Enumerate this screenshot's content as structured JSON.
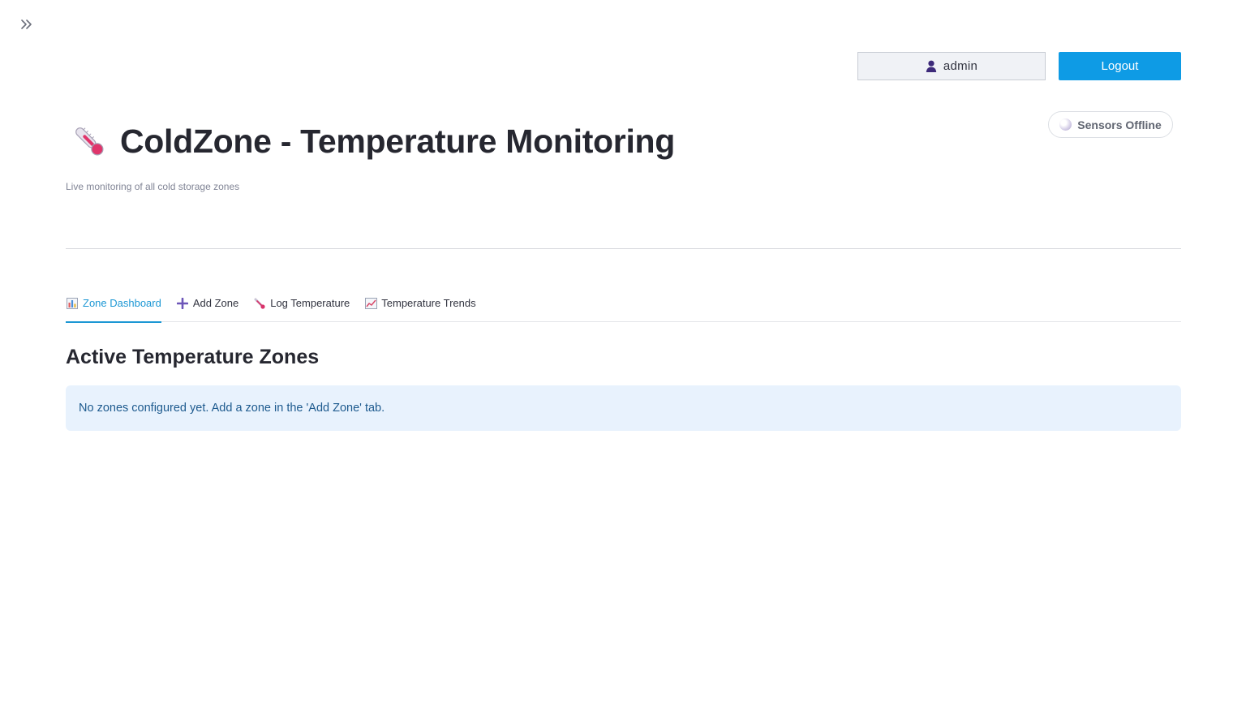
{
  "header": {
    "username": "admin",
    "logout_label": "Logout",
    "status_label": "Sensors Offline"
  },
  "title": {
    "emoji": "🌡️",
    "text": "ColdZone - Temperature Monitoring",
    "subtitle": "Live monitoring of all cold storage zones"
  },
  "tabs": [
    {
      "label": "Zone Dashboard",
      "icon": "bar-chart-icon",
      "active": true
    },
    {
      "label": "Add Zone",
      "icon": "plus-icon",
      "active": false
    },
    {
      "label": "Log Temperature",
      "icon": "thermometer-icon",
      "active": false
    },
    {
      "label": "Temperature Trends",
      "icon": "trend-chart-icon",
      "active": false
    }
  ],
  "main": {
    "heading": "Active Temperature Zones",
    "info_message": "No zones configured yet. Add a zone in the 'Add Zone' tab."
  },
  "colors": {
    "accent": "#0e9be5",
    "active_tab": "#1c97d4",
    "info_bg": "#e8f2fd",
    "info_text": "#1d5a8e"
  }
}
